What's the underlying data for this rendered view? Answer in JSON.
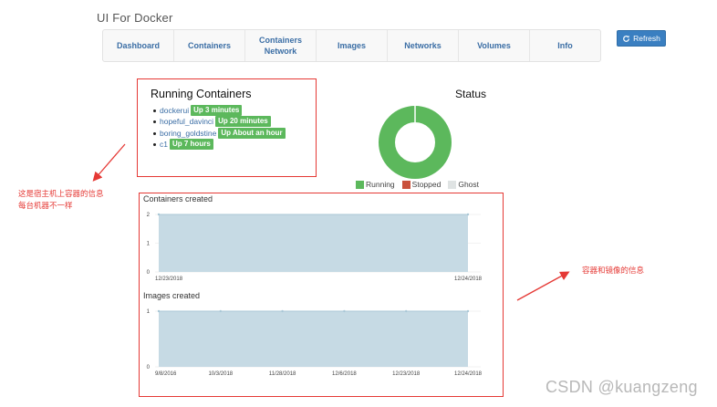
{
  "app": {
    "title": "UI For Docker"
  },
  "nav": {
    "items": [
      {
        "label": "Dashboard"
      },
      {
        "label": "Containers"
      },
      {
        "label": "Containers\nNetwork"
      },
      {
        "label": "Images"
      },
      {
        "label": "Networks"
      },
      {
        "label": "Volumes"
      },
      {
        "label": "Info"
      }
    ],
    "refresh_label": "Refresh"
  },
  "running": {
    "title": "Running Containers",
    "items": [
      {
        "name": "dockerui",
        "status": "Up 3 minutes"
      },
      {
        "name": "hopeful_davinci",
        "status": "Up 20 minutes"
      },
      {
        "name": "boring_goldstine",
        "status": "Up About an hour"
      },
      {
        "name": "c1",
        "status": "Up 7 hours"
      }
    ]
  },
  "status": {
    "title": "Status",
    "legend": [
      {
        "label": "Running",
        "color": "#5cb85c"
      },
      {
        "label": "Stopped",
        "color": "#c9513c"
      },
      {
        "label": "Ghost",
        "color": "#dfe3e3"
      }
    ],
    "values": {
      "Running": 4,
      "Stopped": 0,
      "Ghost": 0
    }
  },
  "chart_data": [
    {
      "type": "area",
      "title": "Containers created",
      "x": [
        "12/23/2018",
        "12/24/2018"
      ],
      "values": [
        2,
        2
      ],
      "y_ticks": [
        "0",
        "1",
        "2"
      ],
      "x_tick_labels": [
        "12/23/2018",
        "12/24/2018"
      ],
      "ylim": [
        0,
        2
      ],
      "fill_color": "#c6dae4",
      "line_color": "#a9c7d6"
    },
    {
      "type": "area",
      "title": "Images created",
      "x": [
        "9/8/2016",
        "10/3/2018",
        "11/28/2018",
        "12/6/2018",
        "12/23/2018",
        "12/24/2018"
      ],
      "values": [
        1,
        1,
        1,
        1,
        1,
        1
      ],
      "y_ticks": [
        "0",
        "1"
      ],
      "x_tick_labels": [
        "9/8/2016",
        "10/3/2018",
        "11/28/2018",
        "12/6/2018",
        "12/23/2018",
        "12/24/2018"
      ],
      "ylim": [
        0,
        1
      ],
      "fill_color": "#c6dae4",
      "line_color": "#a9c7d6"
    }
  ],
  "annotations": {
    "host_info": "这是宿主机上容器的信息\n每台机器不一样",
    "container_image_info": "容器和镜像的信息"
  },
  "watermark": "CSDN @kuangzeng",
  "colors": {
    "accent": "#3a7fc1",
    "annotation": "#e53935"
  }
}
